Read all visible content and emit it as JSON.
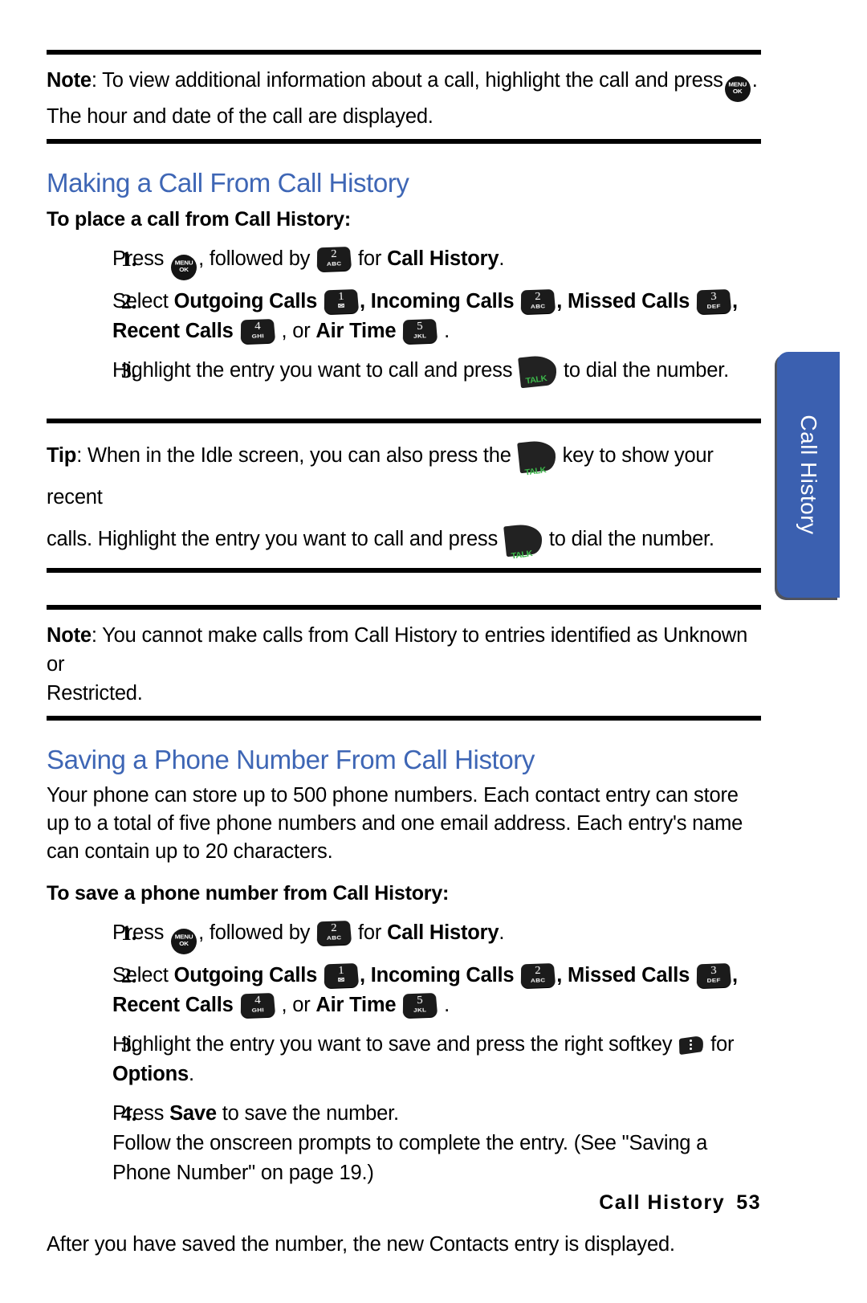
{
  "document": {
    "title": "Call History",
    "page_number": "53"
  },
  "side_tab": {
    "label": "Call History",
    "color": "#3B60B0"
  },
  "footer": {
    "title": "Call History",
    "page": "53"
  },
  "keys": {
    "menu_ok": {
      "name": "menu-ok-key",
      "line1": "MENU",
      "line2": "OK"
    },
    "talk": {
      "name": "talk-key",
      "label": "TALK",
      "label_color": "#3cb54a"
    },
    "right_softkey": {
      "name": "right-softkey",
      "label": ""
    },
    "k1": {
      "digit": "1",
      "letters": "✉"
    },
    "k2": {
      "digit": "2",
      "letters": "ABC"
    },
    "k3": {
      "digit": "3",
      "letters": "DEF"
    },
    "k4": {
      "digit": "4",
      "letters": "GHI"
    },
    "k5": {
      "digit": "5",
      "letters": "JKL"
    }
  },
  "note_top": {
    "label": "Note",
    "text_1": ": To view additional information about a call, highlight the call and press",
    "text_2": ".",
    "text_3": "The hour and date of the call are displayed."
  },
  "section_making": {
    "heading": "Making a Call From Call History",
    "subheading": "To place a call from Call History:",
    "steps": [
      {
        "num": "1.",
        "a": "Press",
        "b": ", followed by",
        "c": "for",
        "d": "Call History",
        "e": "."
      },
      {
        "num": "2.",
        "a": "Select",
        "b": "Outgoing Calls",
        "c": ",",
        "d": "Incoming Calls",
        "e": ",",
        "f": "Missed Calls",
        "g": ",",
        "h": "Recent Calls",
        "i": ", or",
        "j": "Air Time",
        "k": "."
      },
      {
        "num": "3.",
        "a": "Highlight the entry you want to call and press",
        "b": "to dial the number."
      }
    ]
  },
  "tip": {
    "label": "Tip",
    "text_1": ": When in the Idle screen, you can also press the",
    "text_2": "key to show your recent",
    "text_3": "calls. Highlight the entry you want to call and press",
    "text_4": "to dial the number."
  },
  "note_bottom": {
    "label": "Note",
    "text_1": ": You cannot make calls from Call History to entries identified as Unknown or",
    "text_2": "Restricted."
  },
  "section_saving": {
    "heading": "Saving a Phone Number From Call History",
    "intro": "Your phone can store up to 500 phone numbers. Each contact entry can store up to a total of five phone numbers and one email address. Each entry's name can contain up to 20 characters.",
    "subheading": "To save a phone number from Call History:",
    "steps": [
      {
        "num": "1.",
        "a": "Press",
        "b": ", followed by",
        "c": "for",
        "d": "Call History",
        "e": "."
      },
      {
        "num": "2.",
        "a": "Select",
        "b": "Outgoing Calls",
        "c": ",",
        "d": "Incoming Calls",
        "e": ",",
        "f": "Missed Calls",
        "g": ",",
        "h": "Recent Calls",
        "i": ", or",
        "j": "Air Time",
        "k": "."
      },
      {
        "num": "3.",
        "a": "Highlight the entry you want to save and press the right softkey",
        "b": "for",
        "c": "Options",
        "d": "."
      },
      {
        "num": "4.",
        "a": "Press",
        "b": "Save",
        "c": "to save the number.",
        "d": "Follow the onscreen prompts to complete the entry. (See \"Saving a Phone Number\" on page 19.)"
      }
    ],
    "closing": "After you have saved the number, the new Contacts entry is displayed."
  }
}
